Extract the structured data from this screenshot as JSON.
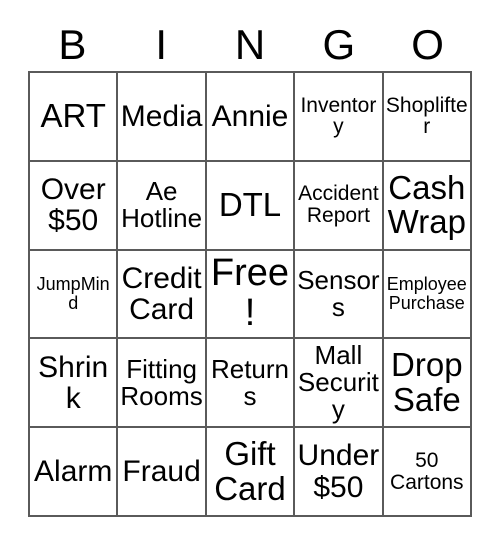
{
  "card": {
    "title": "Bingo Card",
    "headers": [
      "B",
      "I",
      "N",
      "G",
      "O"
    ],
    "rows": [
      [
        {
          "text": "ART",
          "size": "fs-xl"
        },
        {
          "text": "Media",
          "size": "fs-lg"
        },
        {
          "text": "Annie",
          "size": "fs-lg"
        },
        {
          "text": "Inventory",
          "size": "fs-sm"
        },
        {
          "text": "Shoplifter",
          "size": "fs-sm"
        }
      ],
      [
        {
          "text": "Over $50",
          "size": "fs-lg"
        },
        {
          "text": "Ae Hotline",
          "size": "fs-md"
        },
        {
          "text": "DTL",
          "size": "fs-xl"
        },
        {
          "text": "Accident Report",
          "size": "fs-sm"
        },
        {
          "text": "Cash Wrap",
          "size": "fs-xl"
        }
      ],
      [
        {
          "text": "JumpMind",
          "size": "fs-xs"
        },
        {
          "text": "Credit Card",
          "size": "fs-lg"
        },
        {
          "text": "Free!",
          "size": "fs-xxl"
        },
        {
          "text": "Sensors",
          "size": "fs-md"
        },
        {
          "text": "Employee Purchase",
          "size": "fs-xs"
        }
      ],
      [
        {
          "text": "Shrink",
          "size": "fs-lg"
        },
        {
          "text": "Fitting Rooms",
          "size": "fs-md"
        },
        {
          "text": "Returns",
          "size": "fs-md"
        },
        {
          "text": "Mall Security",
          "size": "fs-md"
        },
        {
          "text": "Drop Safe",
          "size": "fs-xl"
        }
      ],
      [
        {
          "text": "Alarm",
          "size": "fs-lg"
        },
        {
          "text": "Fraud",
          "size": "fs-lg"
        },
        {
          "text": "Gift Card",
          "size": "fs-xl"
        },
        {
          "text": "Under $50",
          "size": "fs-lg"
        },
        {
          "text": "50 Cartons",
          "size": "fs-sm"
        }
      ]
    ],
    "colors": {
      "background": "#ffffff",
      "text": "#000000",
      "border": "#5a5a5a"
    }
  }
}
